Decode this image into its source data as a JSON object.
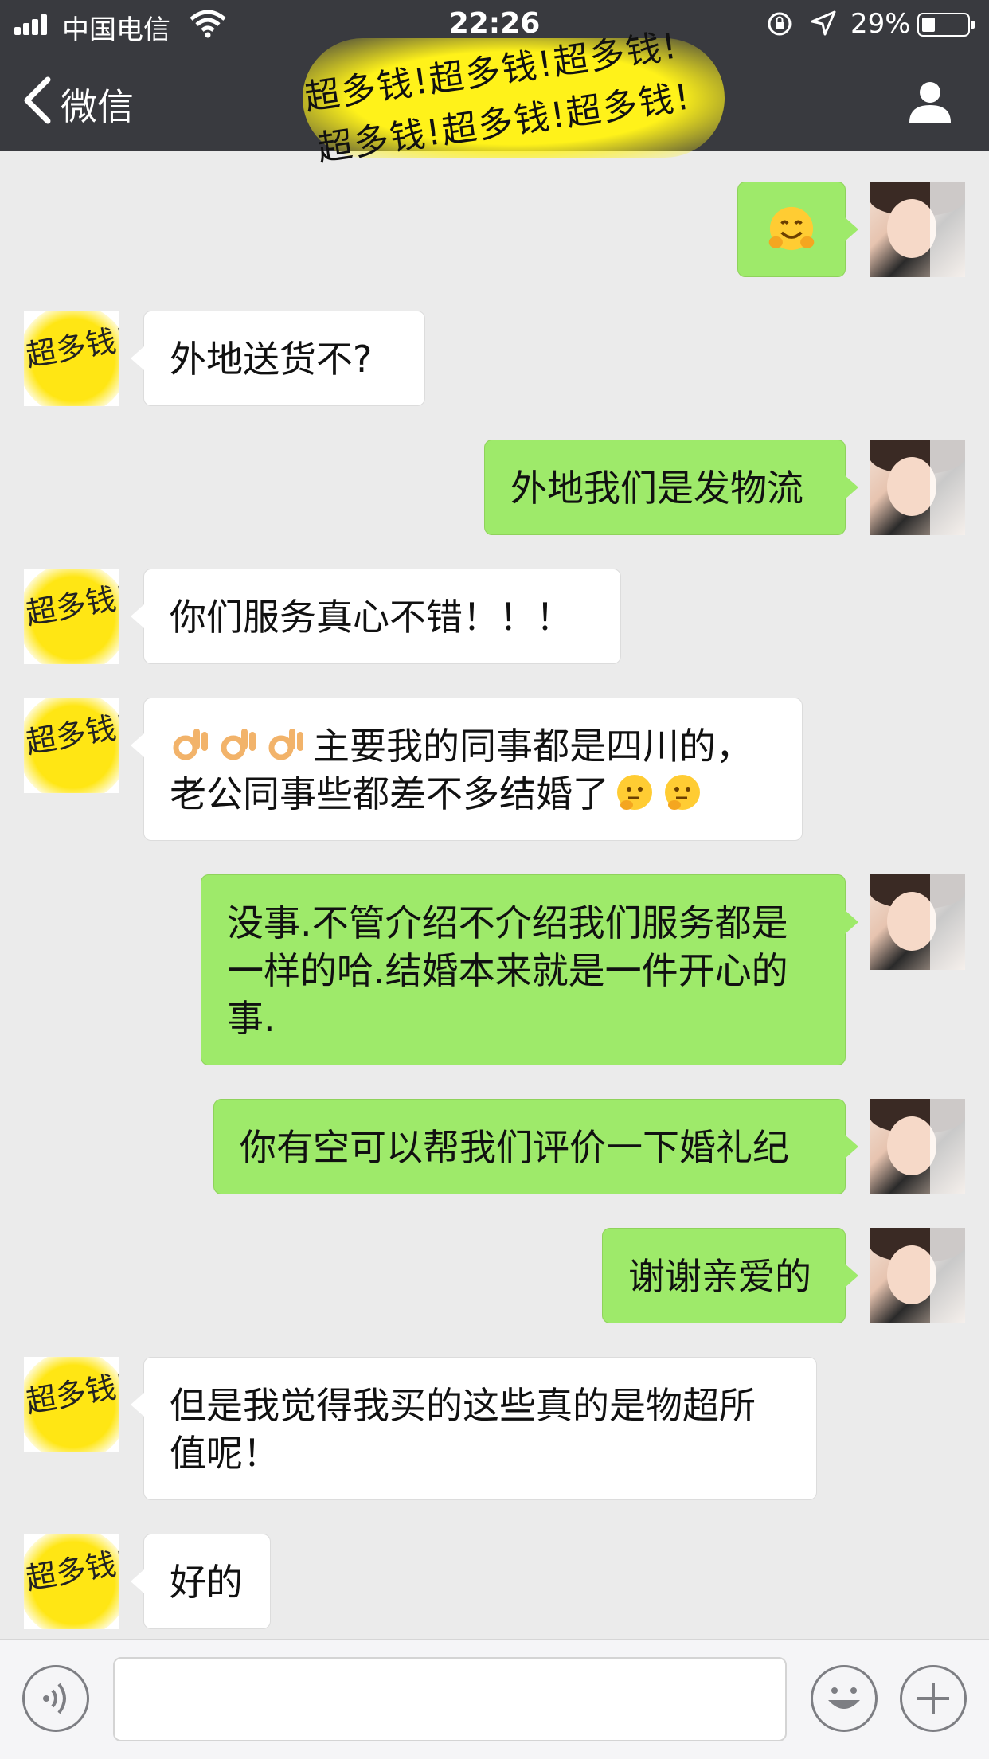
{
  "status_bar": {
    "carrier": "中国电信",
    "time": "22:26",
    "battery_percent": "29%",
    "battery_level": 0.29
  },
  "nav": {
    "back_label": "微信",
    "title_watermark": "超多钱!超多钱!超多钱!"
  },
  "avatar_watermark": "超多钱!",
  "messages": [
    {
      "from": "me",
      "type": "emoji",
      "emoji": "hugging-face-emoji"
    },
    {
      "from": "other",
      "text": "外地送货不?"
    },
    {
      "from": "me",
      "text": "外地我们是发物流"
    },
    {
      "from": "other",
      "text": "你们服务真心不错！！！"
    },
    {
      "from": "other",
      "line1": "主要我的同事都是四川的，",
      "line2": "老公同事些都差不多结婚了",
      "emoji_before": "ok-hand-emoji",
      "emoji_after": "thinking-face-emoji"
    },
    {
      "from": "me",
      "text": "没事.不管介绍不介绍我们服务都是一样的哈.结婚本来就是一件开心的事."
    },
    {
      "from": "me",
      "text": "你有空可以帮我们评价一下婚礼纪"
    },
    {
      "from": "me",
      "text": "谢谢亲爱的"
    },
    {
      "from": "other",
      "text": "但是我觉得我买的这些真的是物超所值呢！"
    },
    {
      "from": "other",
      "text": "好的"
    }
  ],
  "input_bar": {
    "voice_icon": "voice-icon",
    "emoji_icon": "emoji-icon",
    "plus_icon": "plus-icon"
  },
  "colors": {
    "nav_bg": "#393a3f",
    "chat_bg": "#ebebeb",
    "my_bubble": "#9eea6a",
    "other_bubble": "#ffffff"
  }
}
